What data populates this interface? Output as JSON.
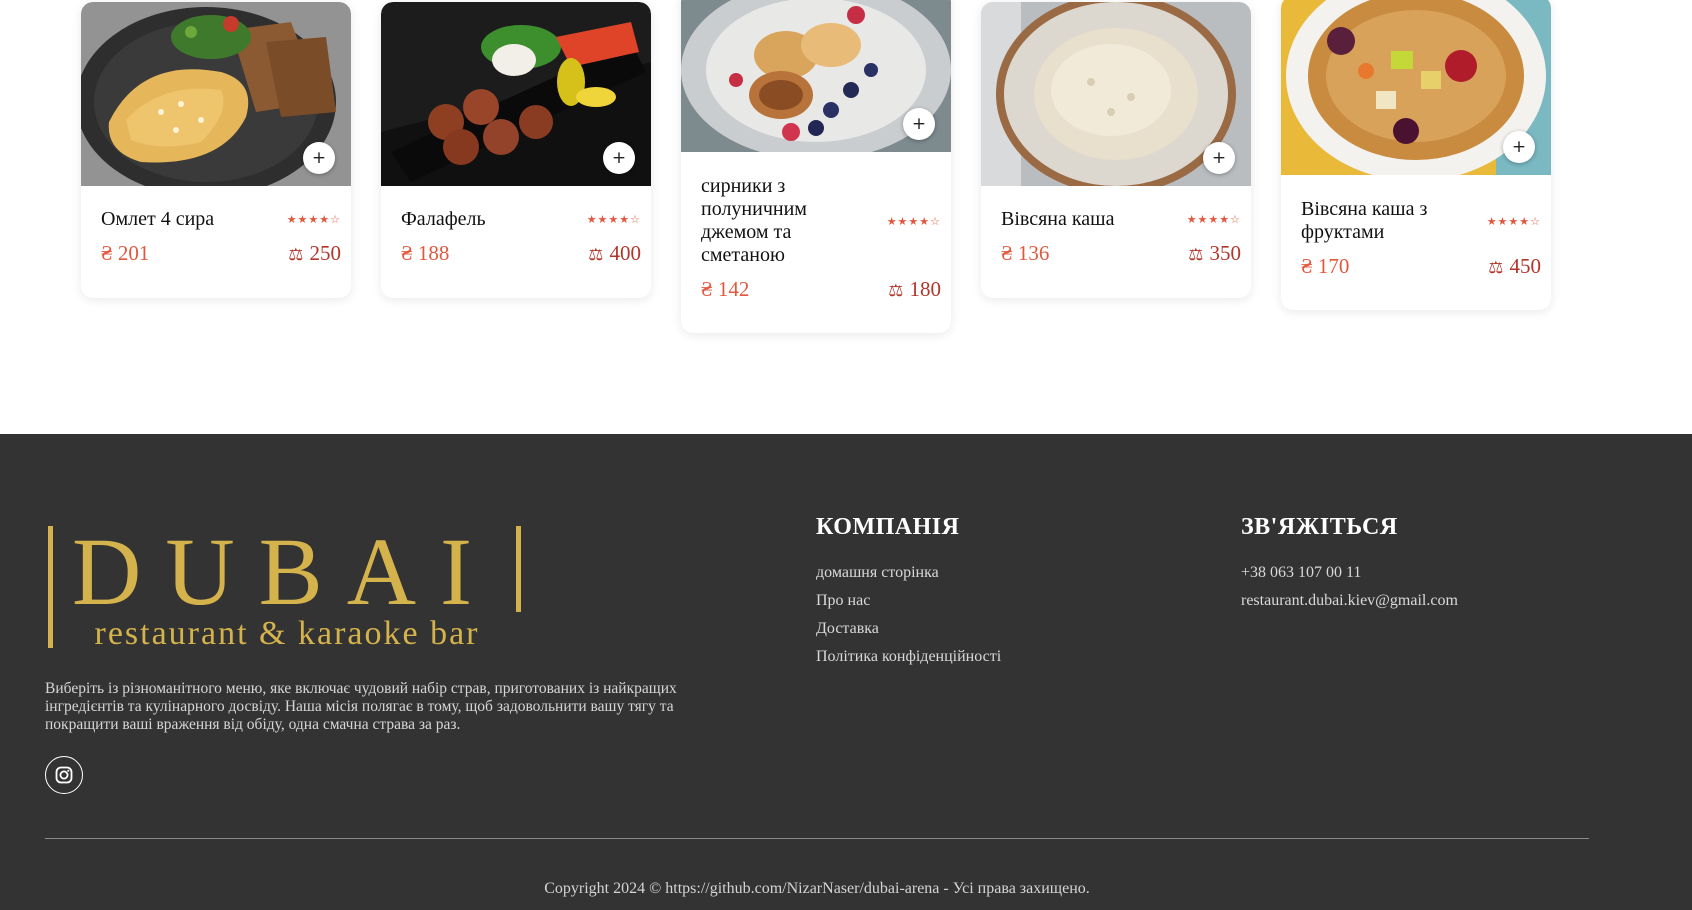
{
  "menu_items": [
    {
      "name": "Омлет 4 сира",
      "price": "₴ 201",
      "weight": "250",
      "rating": 4,
      "add_label": "+"
    },
    {
      "name": "Фалафель",
      "price": "₴ 188",
      "weight": "400",
      "rating": 4,
      "add_label": "+"
    },
    {
      "name": "сирники з полуничним джемом та сметаною",
      "price": "₴ 142",
      "weight": "180",
      "rating": 4,
      "add_label": "+"
    },
    {
      "name": "Вівсяна каша",
      "price": "₴ 136",
      "weight": "350",
      "rating": 4,
      "add_label": "+"
    },
    {
      "name": "Вівсяна каша з фруктами",
      "price": "₴ 170",
      "weight": "450",
      "rating": 4,
      "add_label": "+"
    }
  ],
  "footer": {
    "logo": {
      "main": "DUBAI",
      "sub": "restaurant & karaoke bar",
      "color": "#d4b24c"
    },
    "description": "Виберіть із різноманітного меню, яке включає чудовий набір страв, приготованих із найкращих інгредієнтів та кулінарного досвіду. Наша місія полягає в тому, щоб задовольнити вашу тягу та покращити ваші враження від обіду, одна смачна страва за раз.",
    "social_icon": "instagram-icon",
    "company": {
      "heading": "КОМПАНІЯ",
      "links": [
        "домашня сторінка",
        "Про нас",
        "Доставка",
        "Політика конфіденційності"
      ]
    },
    "contact": {
      "heading": "ЗВ'ЯЖІТЬСЯ",
      "phone": "+38 063 107 00 11",
      "email": "restaurant.dubai.kiev@gmail.com"
    },
    "copyright": "Copyright 2024 © https://github.com/NizarNaser/dubai-arena - Усі права захищено."
  },
  "colors": {
    "accent": "#e2583e",
    "weight": "#b2352a",
    "footer_bg": "#333333",
    "logo_gold": "#d4b24c"
  }
}
